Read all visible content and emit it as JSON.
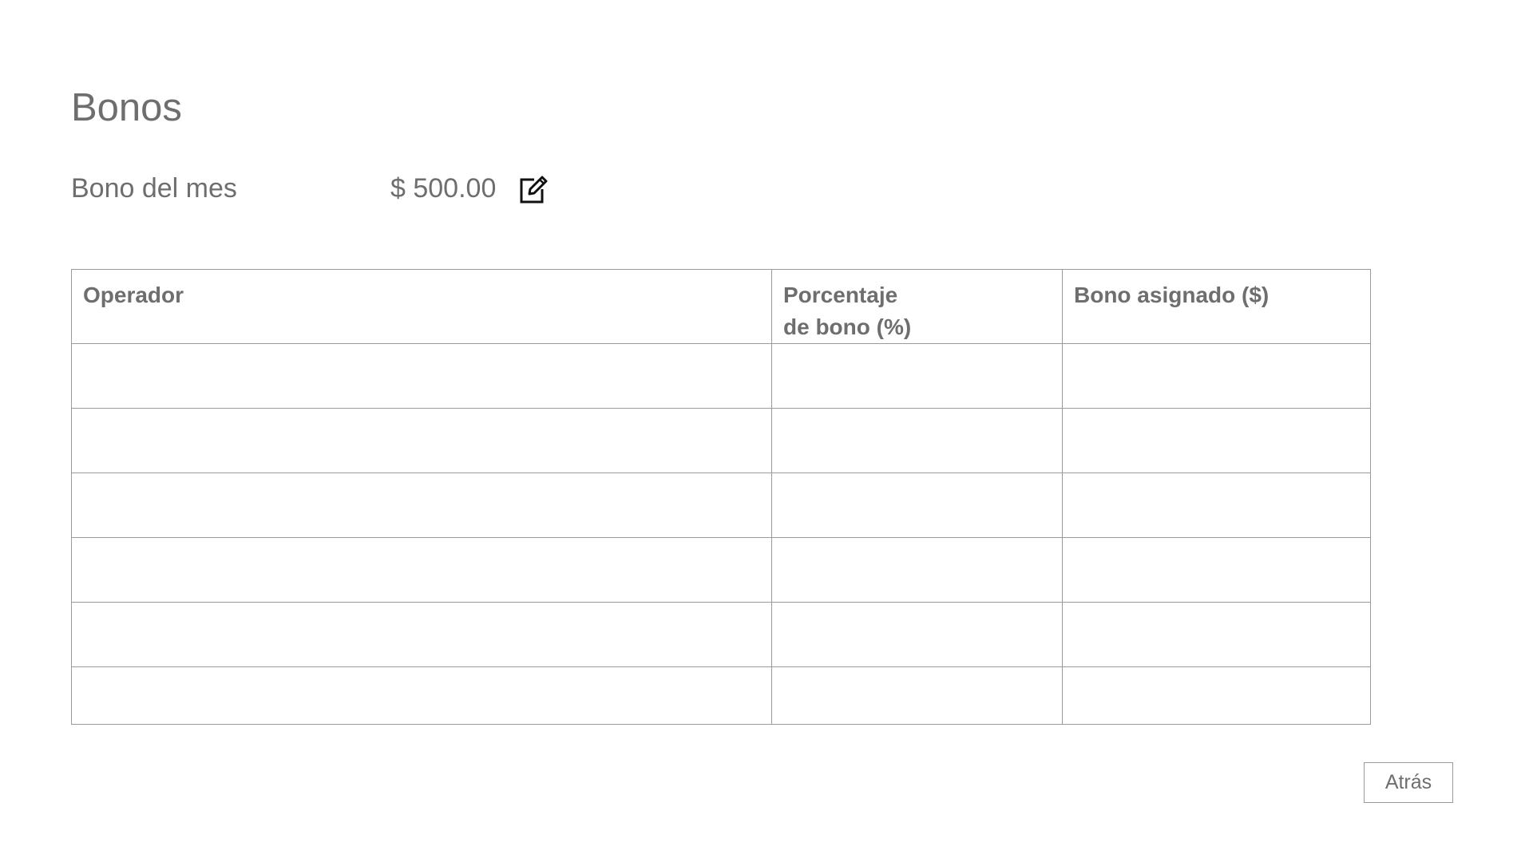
{
  "page": {
    "title": "Bonos"
  },
  "bonus": {
    "label": "Bono del mes",
    "value": "$ 500.00",
    "edit_icon": "edit-icon"
  },
  "table": {
    "columns": [
      "Operador",
      "Porcentaje\nde bono (%)",
      "Bono asignado ($)"
    ],
    "rows": [
      [
        "",
        "",
        ""
      ],
      [
        "",
        "",
        ""
      ],
      [
        "",
        "",
        ""
      ],
      [
        "",
        "",
        ""
      ],
      [
        "",
        "",
        ""
      ],
      [
        "",
        "",
        ""
      ]
    ]
  },
  "footer": {
    "back_label": "Atrás"
  },
  "colors": {
    "text": "#6e6e6e",
    "border": "#9a9a9a",
    "background": "#ffffff"
  }
}
